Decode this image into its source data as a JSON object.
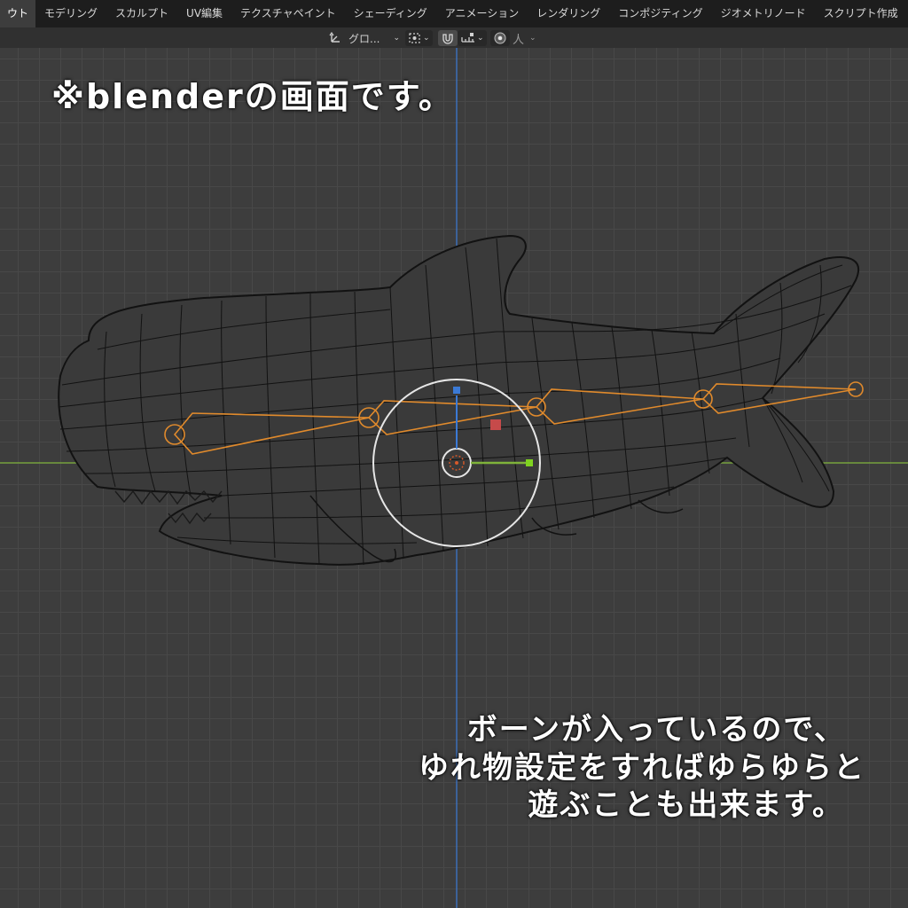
{
  "tabs": [
    {
      "label": "ウト",
      "active": true
    },
    {
      "label": "モデリング",
      "active": false
    },
    {
      "label": "スカルプト",
      "active": false
    },
    {
      "label": "UV編集",
      "active": false
    },
    {
      "label": "テクスチャペイント",
      "active": false
    },
    {
      "label": "シェーディング",
      "active": false
    },
    {
      "label": "アニメーション",
      "active": false
    },
    {
      "label": "レンダリング",
      "active": false
    },
    {
      "label": "コンポジティング",
      "active": false
    },
    {
      "label": "ジオメトリノード",
      "active": false
    },
    {
      "label": "スクリプト作成",
      "active": false
    }
  ],
  "add_tab": "+",
  "toolbar": {
    "orientation_label": "グロ...",
    "orientation_icon": "transform-orientation-icon",
    "pivot_icon": "pivot-point-icon",
    "snap_icon": "snap-magnet-icon",
    "snap_target_icon": "snap-increment-icon",
    "proportional_icon": "proportional-edit-icon",
    "falloff_icon": "falloff-person-icon"
  },
  "overlay_text": {
    "headline": "※blenderの画面です。",
    "caption": [
      "ボーンが入っているので、",
      "ゆれ物設定をすればゆらゆらと",
      "遊ぶことも出来ます。"
    ]
  },
  "colors": {
    "bone": "#e08a2c",
    "x_axis": "#7fb33a",
    "z_axis": "#3b7ad6",
    "gizmo_ring": "#e6e6e6"
  }
}
